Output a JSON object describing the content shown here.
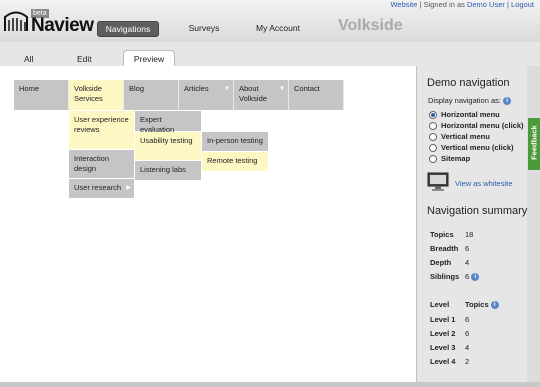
{
  "topnav": {
    "website": "Website",
    "signed": "Signed in as",
    "user": "Demo User",
    "logout": "Logout",
    "sep": "|"
  },
  "logo": {
    "beta": "beta",
    "name": "Naview"
  },
  "mainnav": {
    "navigations": "Navigations",
    "surveys": "Surveys",
    "account": "My Account"
  },
  "brand": "Volkside",
  "tabs": {
    "all": "All",
    "edit": "Edit",
    "preview": "Preview"
  },
  "menu": {
    "top": [
      "Home",
      "Volkside Services",
      "Blog",
      "Articles",
      "About Volkside",
      "Contact"
    ],
    "sub1": [
      "User experience reviews",
      "Interaction design",
      "User research"
    ],
    "sub2": [
      "Expert evaluation",
      "Usability testing",
      "Listening labs"
    ],
    "sub3": [
      "In-person testing",
      "Remote testing"
    ]
  },
  "sidebar": {
    "demo_title": "Demo navigation",
    "display_label": "Display navigation as:",
    "options": [
      "Horizontal menu",
      "Horizontal menu (click)",
      "Vertical menu",
      "Vertical menu (click)",
      "Sitemap"
    ],
    "selected_option": "Horizontal menu",
    "view_link": "View as whitesite",
    "summary_title": "Navigation summary",
    "stats": [
      {
        "label": "Topics",
        "value": "18"
      },
      {
        "label": "Breadth",
        "value": "6"
      },
      {
        "label": "Depth",
        "value": "4"
      },
      {
        "label": "Siblings",
        "value": "6"
      }
    ],
    "levels_header": {
      "level": "Level",
      "topics": "Topics"
    },
    "levels": [
      {
        "label": "Level 1",
        "value": "6"
      },
      {
        "label": "Level 2",
        "value": "6"
      },
      {
        "label": "Level 3",
        "value": "4"
      },
      {
        "label": "Level 4",
        "value": "2"
      }
    ],
    "info": "i"
  },
  "feedback": "Feedback",
  "colors": {
    "accent": "#2a5db0",
    "highlight": "#fdf7c3",
    "menu": "#c5c5c5",
    "feedback": "#4c9a3a"
  }
}
